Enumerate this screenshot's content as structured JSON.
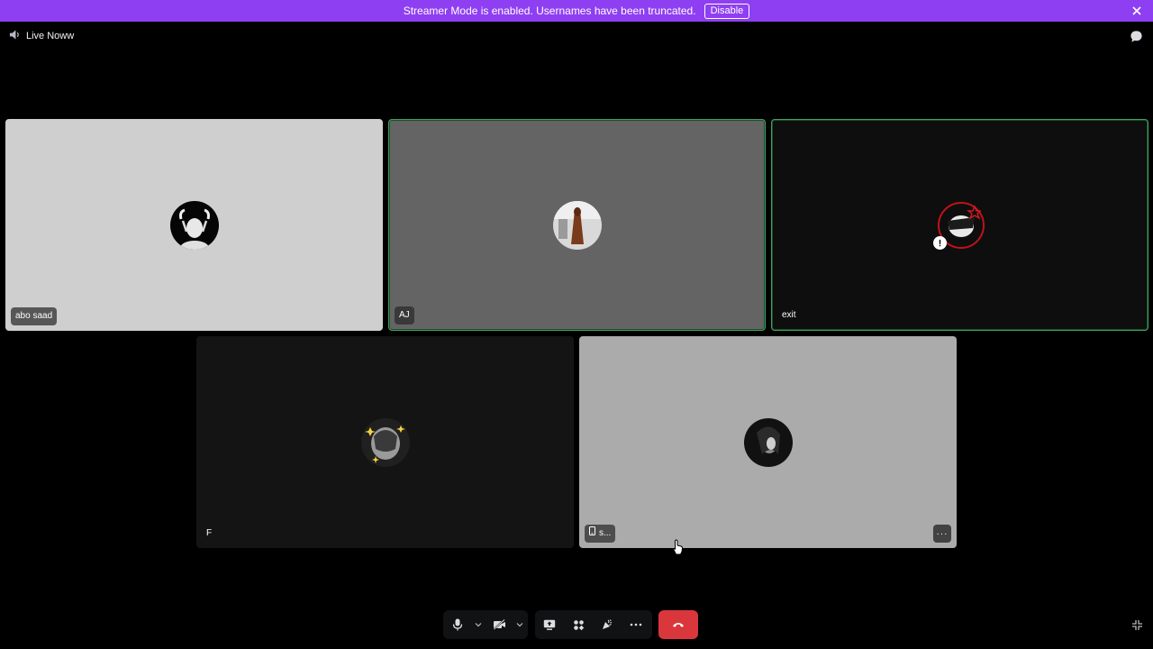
{
  "banner": {
    "text": "Streamer Mode is enabled. Usernames have been truncated.",
    "disable_label": "Disable",
    "close_icon": "close-icon",
    "color": "#8f3ff2"
  },
  "header": {
    "channel_name": "Live Noww",
    "channel_icon": "voice-channel-icon",
    "chat_icon": "chat-bubble-icon"
  },
  "tiles": [
    {
      "name": "abo saad",
      "background": "#cfcfcf",
      "speaking": false
    },
    {
      "name": "AJ",
      "background": "#646464",
      "speaking": true
    },
    {
      "name": "exit",
      "background": "#0e0e0e",
      "speaking": true
    },
    {
      "name": "F",
      "background": "#141414",
      "speaking": false
    },
    {
      "name": "s...",
      "background": "#ababab",
      "speaking": false,
      "device_icon": "mobile-icon",
      "more_icon": "more-options-icon"
    }
  ],
  "controls": {
    "mic_icon": "microphone-icon",
    "camera_icon": "camera-off-icon",
    "screenshare_icon": "screen-share-icon",
    "activities_icon": "activities-icon",
    "soundboard_icon": "soundboard-icon",
    "more_icon": "more-icon",
    "hangup_icon": "disconnect-icon",
    "hangup_color": "#da373c",
    "fullscreen_icon": "exit-fullscreen-icon"
  }
}
